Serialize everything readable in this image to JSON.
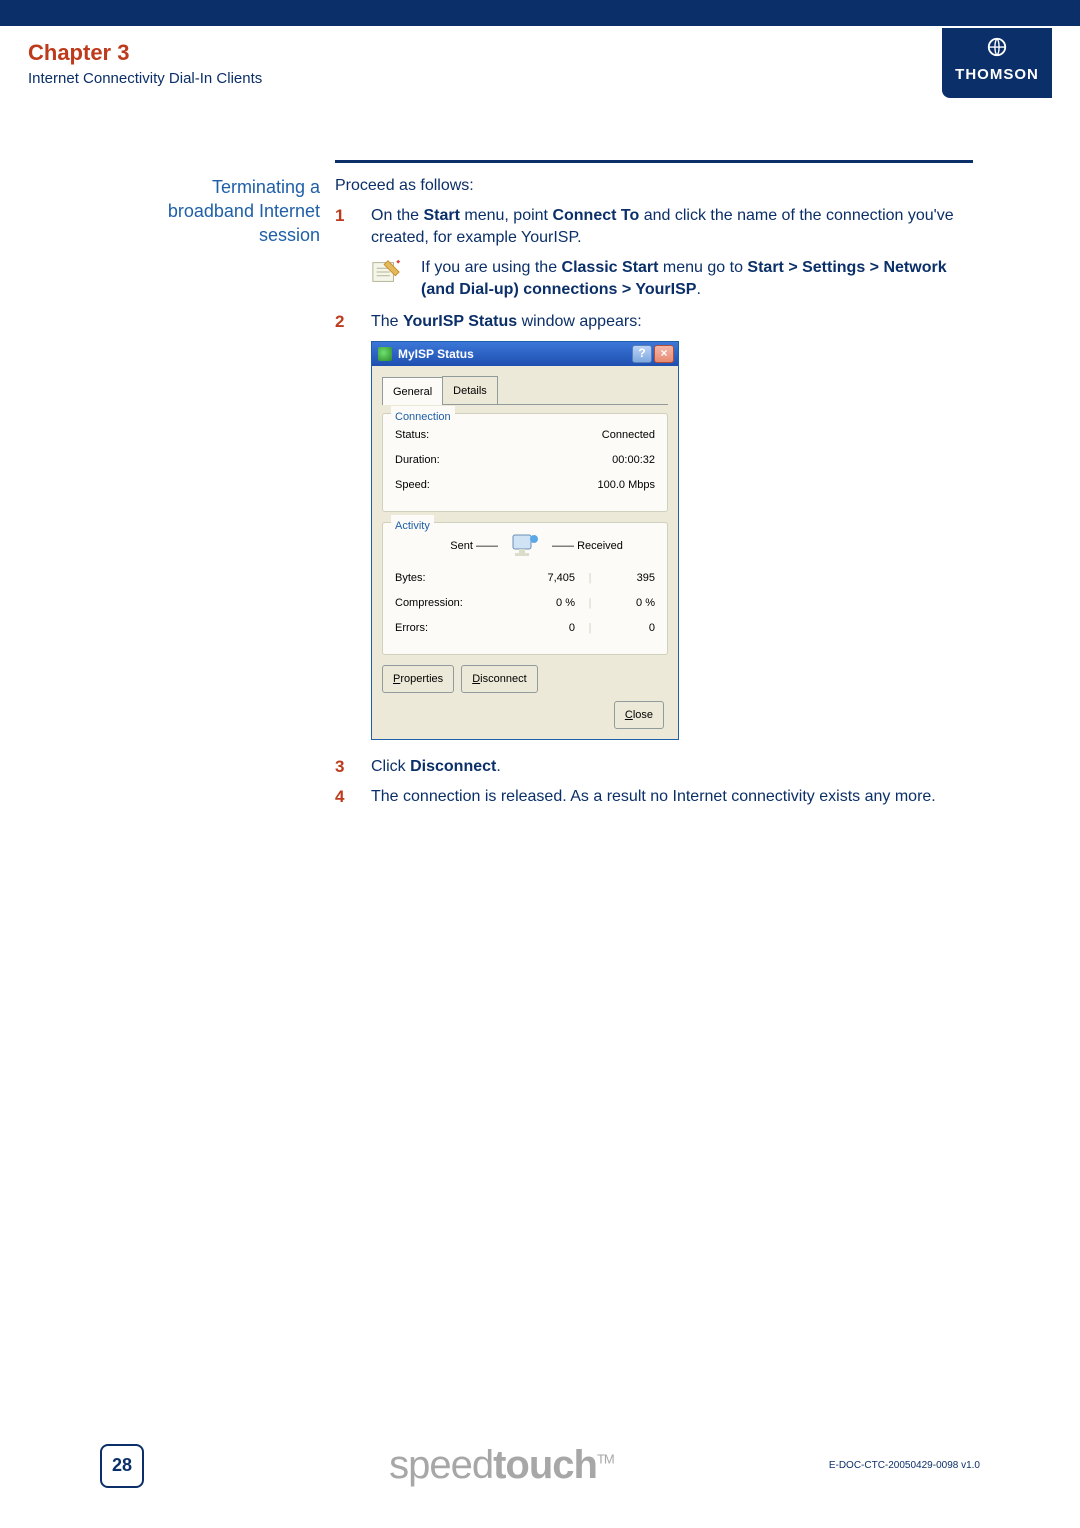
{
  "header": {
    "chapter": "Chapter 3",
    "subtitle": "Internet Connectivity Dial-In Clients",
    "brand": "THOMSON"
  },
  "section_label": "Terminating a broadband Internet session",
  "intro": "Proceed as follows:",
  "steps": {
    "s1": {
      "num": "1",
      "pre": "On the ",
      "b1": "Start",
      "mid1": " menu, point ",
      "b2": "Connect To",
      "post": " and click the name of the connection you've created, for example YourISP."
    },
    "note": {
      "pre": "If you are using the ",
      "b1": "Classic Start",
      "mid": " menu go to ",
      "b2": "Start > Settings > Network (and Dial-up) connections > YourISP",
      "post": "."
    },
    "s2": {
      "num": "2",
      "pre": "The ",
      "b1": "YourISP Status",
      "post": " window appears:"
    },
    "s3": {
      "num": "3",
      "pre": "Click ",
      "b1": "Disconnect",
      "post": "."
    },
    "s4": {
      "num": "4",
      "text": "The connection is released. As a result no Internet connectivity exists any more."
    }
  },
  "dialog": {
    "title": "MyISP Status",
    "tabs": {
      "general": "General",
      "details": "Details"
    },
    "connection": {
      "legend": "Connection",
      "status_k": "Status:",
      "status_v": "Connected",
      "duration_k": "Duration:",
      "duration_v": "00:00:32",
      "speed_k": "Speed:",
      "speed_v": "100.0 Mbps"
    },
    "activity": {
      "legend": "Activity",
      "sent": "Sent",
      "received": "Received",
      "bytes_k": "Bytes:",
      "bytes_s": "7,405",
      "bytes_r": "395",
      "comp_k": "Compression:",
      "comp_s": "0 %",
      "comp_r": "0 %",
      "err_k": "Errors:",
      "err_s": "0",
      "err_r": "0"
    },
    "buttons": {
      "properties": "Properties",
      "disconnect": "Disconnect",
      "close": "Close"
    }
  },
  "footer": {
    "page": "28",
    "brand_light": "speed",
    "brand_bold": "touch",
    "tm": "TM",
    "docid": "E-DOC-CTC-20050429-0098 v1.0"
  }
}
